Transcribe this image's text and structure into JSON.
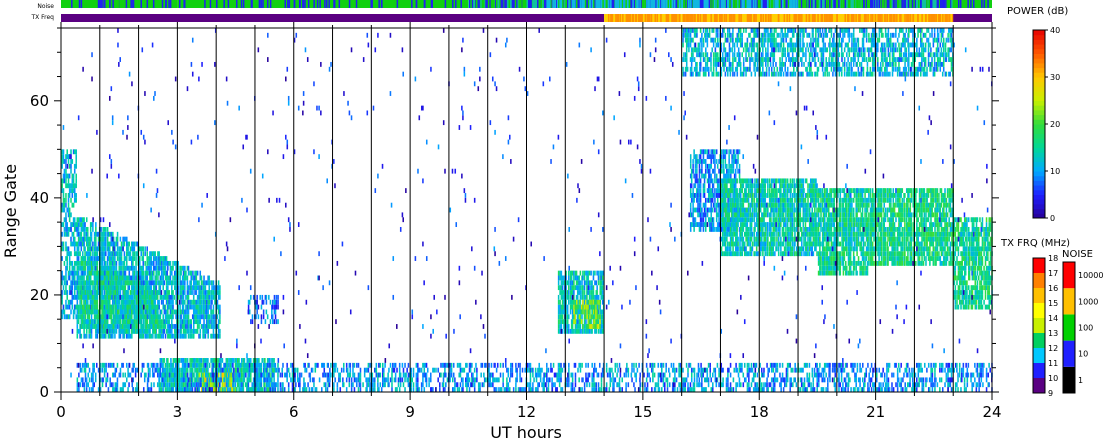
{
  "chart_data": {
    "type": "heatmap",
    "title": "",
    "xlabel": "UT hours",
    "ylabel": "Range Gate",
    "xlim": [
      0,
      24
    ],
    "ylim": [
      0,
      75
    ],
    "xticks": [
      0,
      3,
      6,
      9,
      12,
      15,
      18,
      21,
      24
    ],
    "yticks": [
      0,
      20,
      40,
      60
    ],
    "grid": "vertical lines every hour",
    "scan_lines": [
      1,
      2,
      3,
      4,
      5,
      6,
      7,
      8,
      9,
      10,
      11,
      12,
      13,
      14,
      15,
      16,
      17,
      18,
      19,
      20,
      21,
      22,
      23
    ],
    "echo_regions": [
      {
        "x": [
          0.0,
          0.4
        ],
        "y": [
          15,
          50
        ],
        "power": 12,
        "density": 0.6
      },
      {
        "x": [
          0.4,
          4.1
        ],
        "y_start": [
          11,
          36
        ],
        "y_end": [
          11,
          22
        ],
        "power": 12,
        "density": 0.8
      },
      {
        "x": [
          0.5,
          2.5
        ],
        "y_start": [
          14,
          28
        ],
        "y_end": [
          12,
          20
        ],
        "power": 15,
        "density": 0.7
      },
      {
        "x": [
          2.5,
          5.5
        ],
        "y": [
          0,
          7
        ],
        "power": 14,
        "density": 0.85
      },
      {
        "x": [
          3.5,
          4.5
        ],
        "y": [
          0,
          4
        ],
        "power": 26,
        "density": 0.6
      },
      {
        "x": [
          0.4,
          24
        ],
        "y": [
          0,
          6
        ],
        "power": 10,
        "density": 0.45
      },
      {
        "x": [
          4.8,
          5.6
        ],
        "y": [
          14,
          20
        ],
        "power": 8,
        "density": 0.4
      },
      {
        "x": [
          12.8,
          14.0
        ],
        "y": [
          12,
          25
        ],
        "power": 13,
        "density": 0.8
      },
      {
        "x": [
          13.2,
          13.9
        ],
        "y": [
          13,
          19
        ],
        "power": 22,
        "density": 0.6
      },
      {
        "x": [
          16.2,
          17.5
        ],
        "y": [
          33,
          50
        ],
        "power": 10,
        "density": 0.65
      },
      {
        "x": [
          17.0,
          19.5
        ],
        "y": [
          28,
          44
        ],
        "power": 14,
        "density": 0.85
      },
      {
        "x": [
          19.5,
          20.8
        ],
        "y": [
          24,
          42
        ],
        "power": 15,
        "density": 0.85
      },
      {
        "x": [
          20.8,
          23.0
        ],
        "y": [
          26,
          42
        ],
        "power": 16,
        "density": 0.85
      },
      {
        "x": [
          16.0,
          23.0
        ],
        "y": [
          65,
          75
        ],
        "power": 12,
        "density": 0.6
      },
      {
        "x": [
          23.0,
          24
        ],
        "y": [
          17,
          36
        ],
        "power": 16,
        "density": 0.75
      },
      {
        "x": [
          0,
          24
        ],
        "y": [
          0,
          75
        ],
        "power": 5,
        "density": 0.012
      }
    ],
    "noise_bar": {
      "label": "Noise",
      "segments": [
        {
          "x": [
            0,
            1.5
          ],
          "level": "green"
        },
        {
          "x": [
            1.5,
            3
          ],
          "level": "green"
        },
        {
          "x": [
            3,
            10.5
          ],
          "level": "green"
        },
        {
          "x": [
            10.5,
            12.5
          ],
          "level": "mixed"
        },
        {
          "x": [
            12.5,
            19
          ],
          "level": "blue"
        },
        {
          "x": [
            19,
            23
          ],
          "level": "mixed"
        },
        {
          "x": [
            23,
            24
          ],
          "level": "green"
        }
      ]
    },
    "txfreq_bar": {
      "label": "TX Freq",
      "segments": [
        {
          "x": [
            0,
            14
          ],
          "freq": 10
        },
        {
          "x": [
            14,
            16
          ],
          "freq": 14
        },
        {
          "x": [
            16,
            23
          ],
          "freq": 14
        },
        {
          "x": [
            23,
            24
          ],
          "freq": 10
        }
      ]
    },
    "power_colorbar": {
      "title": "POWER (dB)",
      "ticks": [
        "0",
        "10",
        "20",
        "30",
        "40"
      ],
      "range": [
        0,
        40
      ]
    },
    "txfrq_colorbar": {
      "title": "TX FRQ (MHz)",
      "ticks": [
        "9",
        "10",
        "11",
        "12",
        "13",
        "14",
        "15",
        "16",
        "17",
        "18"
      ],
      "colors": [
        "#5a0082",
        "#2020ff",
        "#00c8ff",
        "#00d060",
        "#c8f000",
        "#ffff00",
        "#ffc000",
        "#ff8000",
        "#ff0000"
      ]
    },
    "noise_colorbar": {
      "title": "NOISE",
      "ticks": [
        "1",
        "10",
        "100",
        "1000",
        "10000"
      ],
      "colors": [
        "#000000",
        "#2020ff",
        "#00d000",
        "#ffc000",
        "#ff0000"
      ]
    }
  }
}
